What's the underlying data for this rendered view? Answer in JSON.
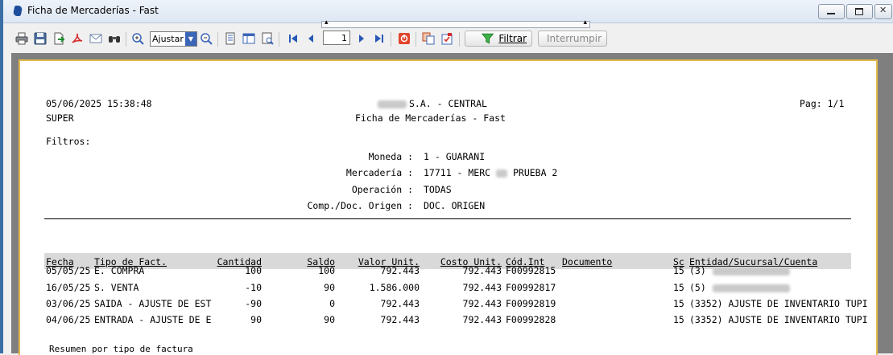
{
  "window": {
    "title": "Ficha de Mercaderías - Fast",
    "minimize_icon": "minimize-icon",
    "maximize_icon": "maximize-icon",
    "close_icon": "close-icon"
  },
  "toolbar": {
    "zoom_value": "Ajustar a",
    "page_number": "1",
    "filter_label": "Filtrar",
    "stop_label": "Interrumpir",
    "icons": [
      "print-icon",
      "save-icon",
      "export-icon",
      "pdf-icon",
      "email-icon",
      "find-icon",
      "zoom-in-icon",
      "zoom-out-icon",
      "page-setup-icon",
      "layout-icon",
      "tree-icon",
      "first-page-icon",
      "prev-page-icon",
      "next-page-icon",
      "last-page-icon",
      "stop-icon",
      "copy-icon",
      "parameters-icon",
      "filter-icon",
      "interrupt-icon"
    ],
    "colors": {
      "accent": "#3b66b8",
      "pdf": "#d62b2b",
      "stop": "#e0452b"
    }
  },
  "report": {
    "datetime": "05/06/2025 15:38:48",
    "user": "SUPER",
    "company_suffix": "S.A. - CENTRAL",
    "report_title": "Ficha de Mercaderías - Fast",
    "page_label": "Pag: 1/1",
    "filters_label": "Filtros:",
    "filters": [
      {
        "label": "Moneda :",
        "value": "1 - GUARANI"
      },
      {
        "label": "Mercadería :",
        "value_prefix": "17711 - MERC",
        "value_suffix": "PRUEBA 2"
      },
      {
        "label": "Operación :",
        "value": "TODAS"
      },
      {
        "label": "Comp./Doc. Origen :",
        "value": "DOC. ORIGEN"
      }
    ],
    "columns": {
      "fecha": "Fecha",
      "tipo": "Tipo de Fact.",
      "cantidad": "Cantidad",
      "saldo": "Saldo",
      "valor": "Valor Unit.",
      "costo": "Costo Unit.",
      "cod": "Cód.Int",
      "documento": "Documento",
      "sc": "Sc",
      "entidad": "Entidad/Sucursal/Cuenta"
    },
    "rows": [
      {
        "fecha": "05/05/25",
        "tipo": "E. COMPRA",
        "cantidad": "100",
        "saldo": "100",
        "valor": "792.443",
        "costo": "792.443",
        "cod": "F00992815",
        "sc": "15",
        "entidad": "(3)",
        "entidad_redacted": true
      },
      {
        "fecha": "16/05/25",
        "tipo": "S. VENTA",
        "cantidad": "-10",
        "saldo": "90",
        "valor": "1.586.000",
        "costo": "792.443",
        "cod": "F00992817",
        "sc": "15",
        "entidad": "(5)",
        "entidad_redacted": true
      },
      {
        "fecha": "03/06/25",
        "tipo": "SAIDA - AJUSTE DE EST",
        "cantidad": "-90",
        "saldo": "0",
        "valor": "792.443",
        "costo": "792.443",
        "cod": "F00992819",
        "sc": "15",
        "entidad": "(3352) AJUSTE DE INVENTARIO TUPI",
        "entidad_redacted": false
      },
      {
        "fecha": "04/06/25",
        "tipo": "ENTRADA - AJUSTE DE E",
        "cantidad": "90",
        "saldo": "90",
        "valor": "792.443",
        "costo": "792.443",
        "cod": "F00992828",
        "sc": "15",
        "entidad": "(3352) AJUSTE DE INVENTARIO TUPI",
        "entidad_redacted": false
      }
    ],
    "summary_label": "Resumen por tipo de factura"
  }
}
